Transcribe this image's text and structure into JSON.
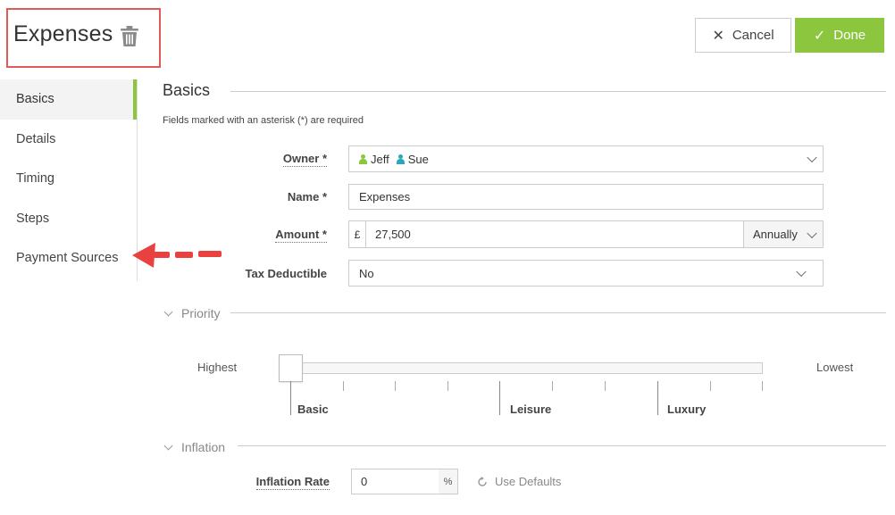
{
  "header": {
    "title": "Expenses",
    "cancel_label": "Cancel",
    "done_label": "Done"
  },
  "sidebar": {
    "items": [
      {
        "label": "Basics",
        "active": true
      },
      {
        "label": "Details"
      },
      {
        "label": "Timing"
      },
      {
        "label": "Steps"
      },
      {
        "label": "Payment Sources"
      }
    ]
  },
  "form": {
    "section_title": "Basics",
    "required_note": "Fields marked with an asterisk (*) are required",
    "owner_label": "Owner *",
    "owners": [
      {
        "name": "Jeff",
        "color": "#8cc63f"
      },
      {
        "name": "Sue",
        "color": "#2aa8b8"
      }
    ],
    "name_label": "Name *",
    "name_value": "Expenses",
    "amount_label": "Amount *",
    "currency_symbol": "£",
    "amount_value": "27,500",
    "frequency": "Annually",
    "tax_label": "Tax Deductible",
    "tax_value": "No"
  },
  "priority": {
    "heading": "Priority",
    "low_end_label": "Highest",
    "high_end_label": "Lowest",
    "ticks": [
      "Basic",
      "Leisure",
      "Luxury"
    ],
    "value": "Basic"
  },
  "inflation": {
    "heading": "Inflation",
    "rate_label": "Inflation Rate",
    "rate_value": "0",
    "unit": "%",
    "use_defaults_label": "Use Defaults"
  },
  "colors": {
    "accent": "#8cc63f",
    "highlight_box": "#e05a5a",
    "arrow": "#e8413f"
  }
}
